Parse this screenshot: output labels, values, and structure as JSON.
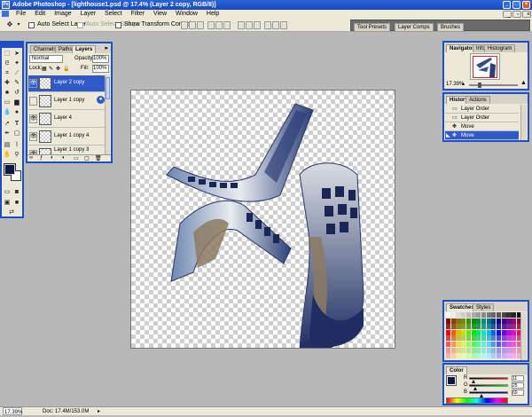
{
  "window": {
    "title": "Adobe Photoshop - [lighthouse1.psd @ 17.4% (Layer 2 copy, RGB/8)]"
  },
  "menu": [
    "File",
    "Edit",
    "Image",
    "Layer",
    "Select",
    "Filter",
    "View",
    "Window",
    "Help"
  ],
  "options": {
    "auto_select_layer": "Auto Select Layer",
    "auto_select_groups": "Auto Select Groups",
    "show_transform_controls": "Show Transform Controls"
  },
  "palette_well": [
    "Tool Presets",
    "Layer Comps",
    "Brushes"
  ],
  "layers_panel": {
    "tabs": [
      "Channels",
      "Paths",
      "Layers"
    ],
    "blend_mode": "Normal",
    "opacity_label": "Opacity:",
    "opacity": "100%",
    "lock_label": "Lock:",
    "fill_label": "Fill:",
    "fill": "100%",
    "layers": [
      {
        "name": "Layer 2 copy",
        "selected": true
      },
      {
        "name": "Layer 1 copy",
        "selected": false
      },
      {
        "name": "Layer 4",
        "selected": false
      },
      {
        "name": "Layer 1 copy 4",
        "selected": false
      },
      {
        "name": "Layer 1 copy 3",
        "selected": false
      }
    ]
  },
  "navigator": {
    "tabs": [
      "Navigator",
      "Info",
      "Histogram"
    ],
    "zoom": "17.39%"
  },
  "history": {
    "tabs": [
      "History",
      "Actions"
    ],
    "items": [
      {
        "label": "Layer Order",
        "selected": false
      },
      {
        "label": "Layer Order",
        "selected": false
      },
      {
        "label": "Move",
        "selected": false
      },
      {
        "label": "Move",
        "selected": true
      }
    ]
  },
  "swatches": {
    "tabs": [
      "Swatches",
      "Styles"
    ]
  },
  "color_panel": {
    "tabs": [
      "Color"
    ],
    "channels": [
      {
        "label": "R",
        "value": "11",
        "fraction": 0.04
      },
      {
        "label": "G",
        "value": "25",
        "fraction": 0.1
      },
      {
        "label": "B",
        "value": "69",
        "fraction": 0.27
      }
    ]
  },
  "status": {
    "zoom": "17.39%",
    "doc": "Doc: 17.4M/153.0M"
  },
  "colors": {
    "foreground": "#0b1945",
    "background": "#ffffff",
    "accent": "#1d50c8"
  }
}
